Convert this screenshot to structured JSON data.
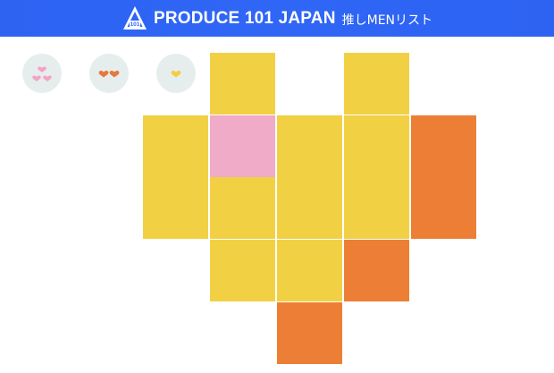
{
  "header": {
    "title": "PRODUCE 101 JAPAN",
    "subtitle": "推しMENリスト",
    "logo_icon": "produce-101-logo-icon",
    "background": "#2f66f6"
  },
  "filters": [
    {
      "id": "all",
      "icon": "three-hearts-icon",
      "color": "#f5a3c4"
    },
    {
      "id": "two",
      "icon": "two-hearts-icon",
      "color": "#e8773a"
    },
    {
      "id": "one",
      "icon": "one-heart-icon",
      "color": "#f2cf44"
    }
  ],
  "colors": {
    "yellow": "#f2d044",
    "pink": "#efabc8",
    "orange": "#ec7f35",
    "filter_bg": "#e6eeed"
  },
  "grid": [
    {
      "row": 0,
      "col": 1,
      "color": "yellow"
    },
    {
      "row": 0,
      "col": 3,
      "color": "yellow"
    },
    {
      "row": 1,
      "col": 0,
      "color": "yellow"
    },
    {
      "row": 1,
      "col": 1,
      "color": "pink"
    },
    {
      "row": 1,
      "col": 2,
      "color": "yellow"
    },
    {
      "row": 1,
      "col": 3,
      "color": "yellow"
    },
    {
      "row": 1,
      "col": 4,
      "color": "orange"
    },
    {
      "row": 2,
      "col": 0,
      "color": "yellow"
    },
    {
      "row": 2,
      "col": 1,
      "color": "yellow"
    },
    {
      "row": 2,
      "col": 2,
      "color": "yellow"
    },
    {
      "row": 2,
      "col": 3,
      "color": "yellow"
    },
    {
      "row": 2,
      "col": 4,
      "color": "orange"
    },
    {
      "row": 3,
      "col": 1,
      "color": "yellow"
    },
    {
      "row": 3,
      "col": 2,
      "color": "yellow"
    },
    {
      "row": 3,
      "col": 3,
      "color": "orange"
    },
    {
      "row": 4,
      "col": 2,
      "color": "orange"
    }
  ]
}
